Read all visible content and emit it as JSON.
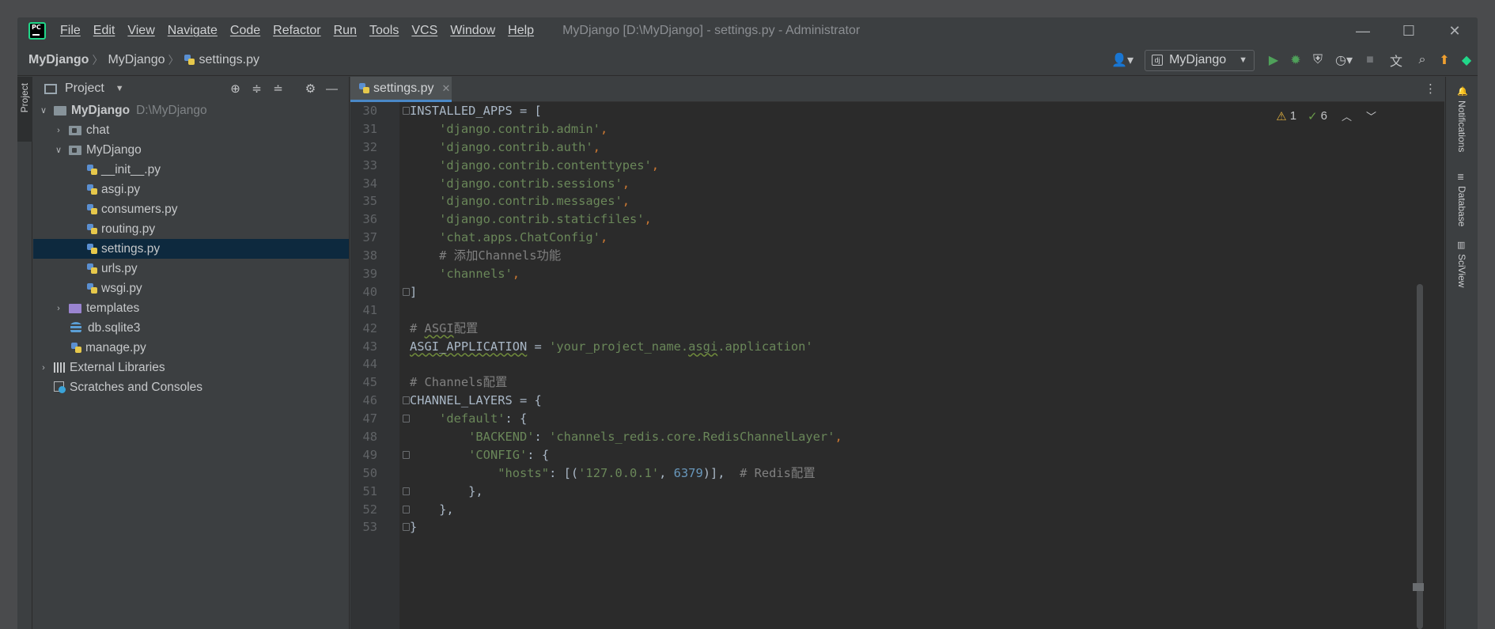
{
  "window": {
    "title": "MyDjango [D:\\MyDjango] - settings.py - Administrator",
    "controls": [
      "—",
      "☐",
      "✕"
    ]
  },
  "menu": [
    "File",
    "Edit",
    "View",
    "Navigate",
    "Code",
    "Refactor",
    "Run",
    "Tools",
    "VCS",
    "Window",
    "Help"
  ],
  "breadcrumb": [
    "MyDjango",
    "MyDjango",
    "settings.py"
  ],
  "run_config": "MyDjango",
  "left_strip": {
    "tab": "Project"
  },
  "project_panel": {
    "title": "Project",
    "tree": [
      {
        "label": "MyDjango",
        "hint": "D:\\MyDjango"
      },
      {
        "label": "chat"
      },
      {
        "label": "MyDjango"
      },
      {
        "label": "__init__.py"
      },
      {
        "label": "asgi.py"
      },
      {
        "label": "consumers.py"
      },
      {
        "label": "routing.py"
      },
      {
        "label": "settings.py"
      },
      {
        "label": "urls.py"
      },
      {
        "label": "wsgi.py"
      },
      {
        "label": "templates"
      },
      {
        "label": "db.sqlite3"
      },
      {
        "label": "manage.py"
      },
      {
        "label": "External Libraries"
      },
      {
        "label": "Scratches and Consoles"
      }
    ]
  },
  "editor": {
    "tab": "settings.py",
    "inspections": {
      "warnings": "1",
      "weak": "6"
    },
    "line_numbers": [
      "30",
      "31",
      "32",
      "33",
      "34",
      "35",
      "36",
      "37",
      "38",
      "39",
      "40",
      "41",
      "42",
      "43",
      "44",
      "45",
      "46",
      "47",
      "48",
      "49",
      "50",
      "51",
      "52",
      "53"
    ],
    "code": {
      "l30": "INSTALLED_APPS = [",
      "l31": "'django.contrib.admin'",
      "l32": "'django.contrib.auth'",
      "l33": "'django.contrib.contenttypes'",
      "l34": "'django.contrib.sessions'",
      "l35": "'django.contrib.messages'",
      "l36": "'django.contrib.staticfiles'",
      "l37": "'chat.apps.ChatConfig'",
      "l38": "# 添加Channels功能",
      "l39": "'channels'",
      "l40": "]",
      "l42a": "# ",
      "l42b": "ASGI",
      "l42c": "配置",
      "l43a": "ASGI_APPLICATION",
      "l43b": " = ",
      "l43c": "'your_project_name.",
      "l43d": "asgi",
      "l43e": ".application'",
      "l45": "# Channels配置",
      "l46": "CHANNEL_LAYERS = {",
      "l47a": "'default'",
      "l47b": ": {",
      "l48a": "'BACKEND'",
      "l48b": ": ",
      "l48c": "'channels_redis.core.RedisChannelLayer'",
      "l49a": "'CONFIG'",
      "l49b": ": {",
      "l50a": "\"hosts\"",
      "l50b": ": [(",
      "l50c": "'127.0.0.1'",
      "l50d": ", ",
      "l50e": "6379",
      "l50f": ")],  ",
      "l50g": "# Redis配置",
      "l51": "},",
      "l52": "},",
      "l53": "}"
    }
  },
  "right_strip": [
    "Notifications",
    "Database",
    "SciView"
  ],
  "colors": {
    "string": "#6a8759",
    "comment": "#808080",
    "number": "#6897bb",
    "text": "#a9b7c6",
    "selection": "#0d293e",
    "run": "#4fa15a",
    "update": "#f0a030"
  }
}
